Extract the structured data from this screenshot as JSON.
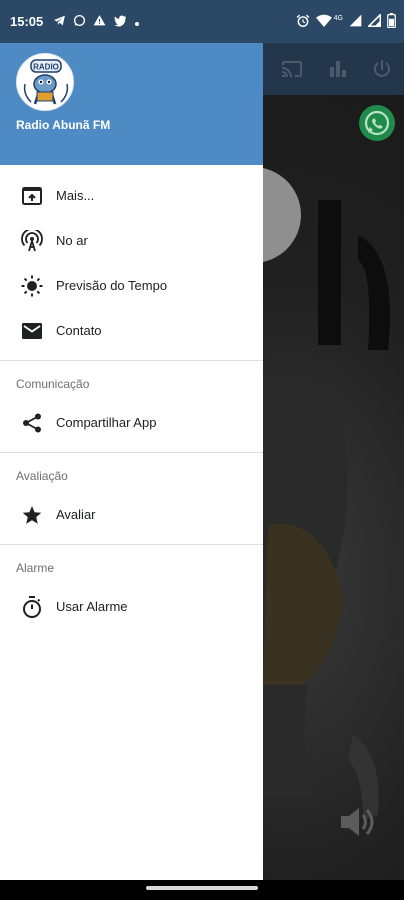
{
  "status_bar": {
    "time": "15:05",
    "left_icons": [
      "telegram-icon",
      "whatsapp-icon",
      "warning-icon",
      "twitter-icon",
      "dot-icon"
    ],
    "right_icons": [
      "alarm-icon",
      "wifi-icon",
      "signal-icon",
      "signal-icon",
      "battery-icon"
    ],
    "network_label": "4G"
  },
  "drawer": {
    "header": {
      "station_name": "Radio Abunã FM",
      "logo_icon": "radio-logo-icon"
    },
    "items": [
      {
        "label": "Mais...",
        "icon": "open-in-new-icon"
      },
      {
        "label": "No ar",
        "icon": "broadcast-icon"
      },
      {
        "label": "Previsão do Tempo",
        "icon": "sun-icon"
      },
      {
        "label": "Contato",
        "icon": "mail-icon"
      }
    ],
    "sections": [
      {
        "title": "Comunicação",
        "items": [
          {
            "label": "Compartilhar App",
            "icon": "share-icon"
          }
        ]
      },
      {
        "title": "Avaliação",
        "items": [
          {
            "label": "Avaliar",
            "icon": "star-icon"
          }
        ]
      },
      {
        "title": "Alarme",
        "items": [
          {
            "label": "Usar Alarme",
            "icon": "timer-icon"
          }
        ]
      }
    ]
  },
  "background_app": {
    "toolbar_icons": [
      "cast-icon",
      "equalizer-icon",
      "power-icon"
    ],
    "whatsapp_button_icon": "whatsapp-icon",
    "volume_icon": "volume-icon"
  },
  "colors": {
    "status_bar": "#2b4866",
    "drawer_header": "#4e8ac4",
    "toolbar": "#24364a"
  }
}
